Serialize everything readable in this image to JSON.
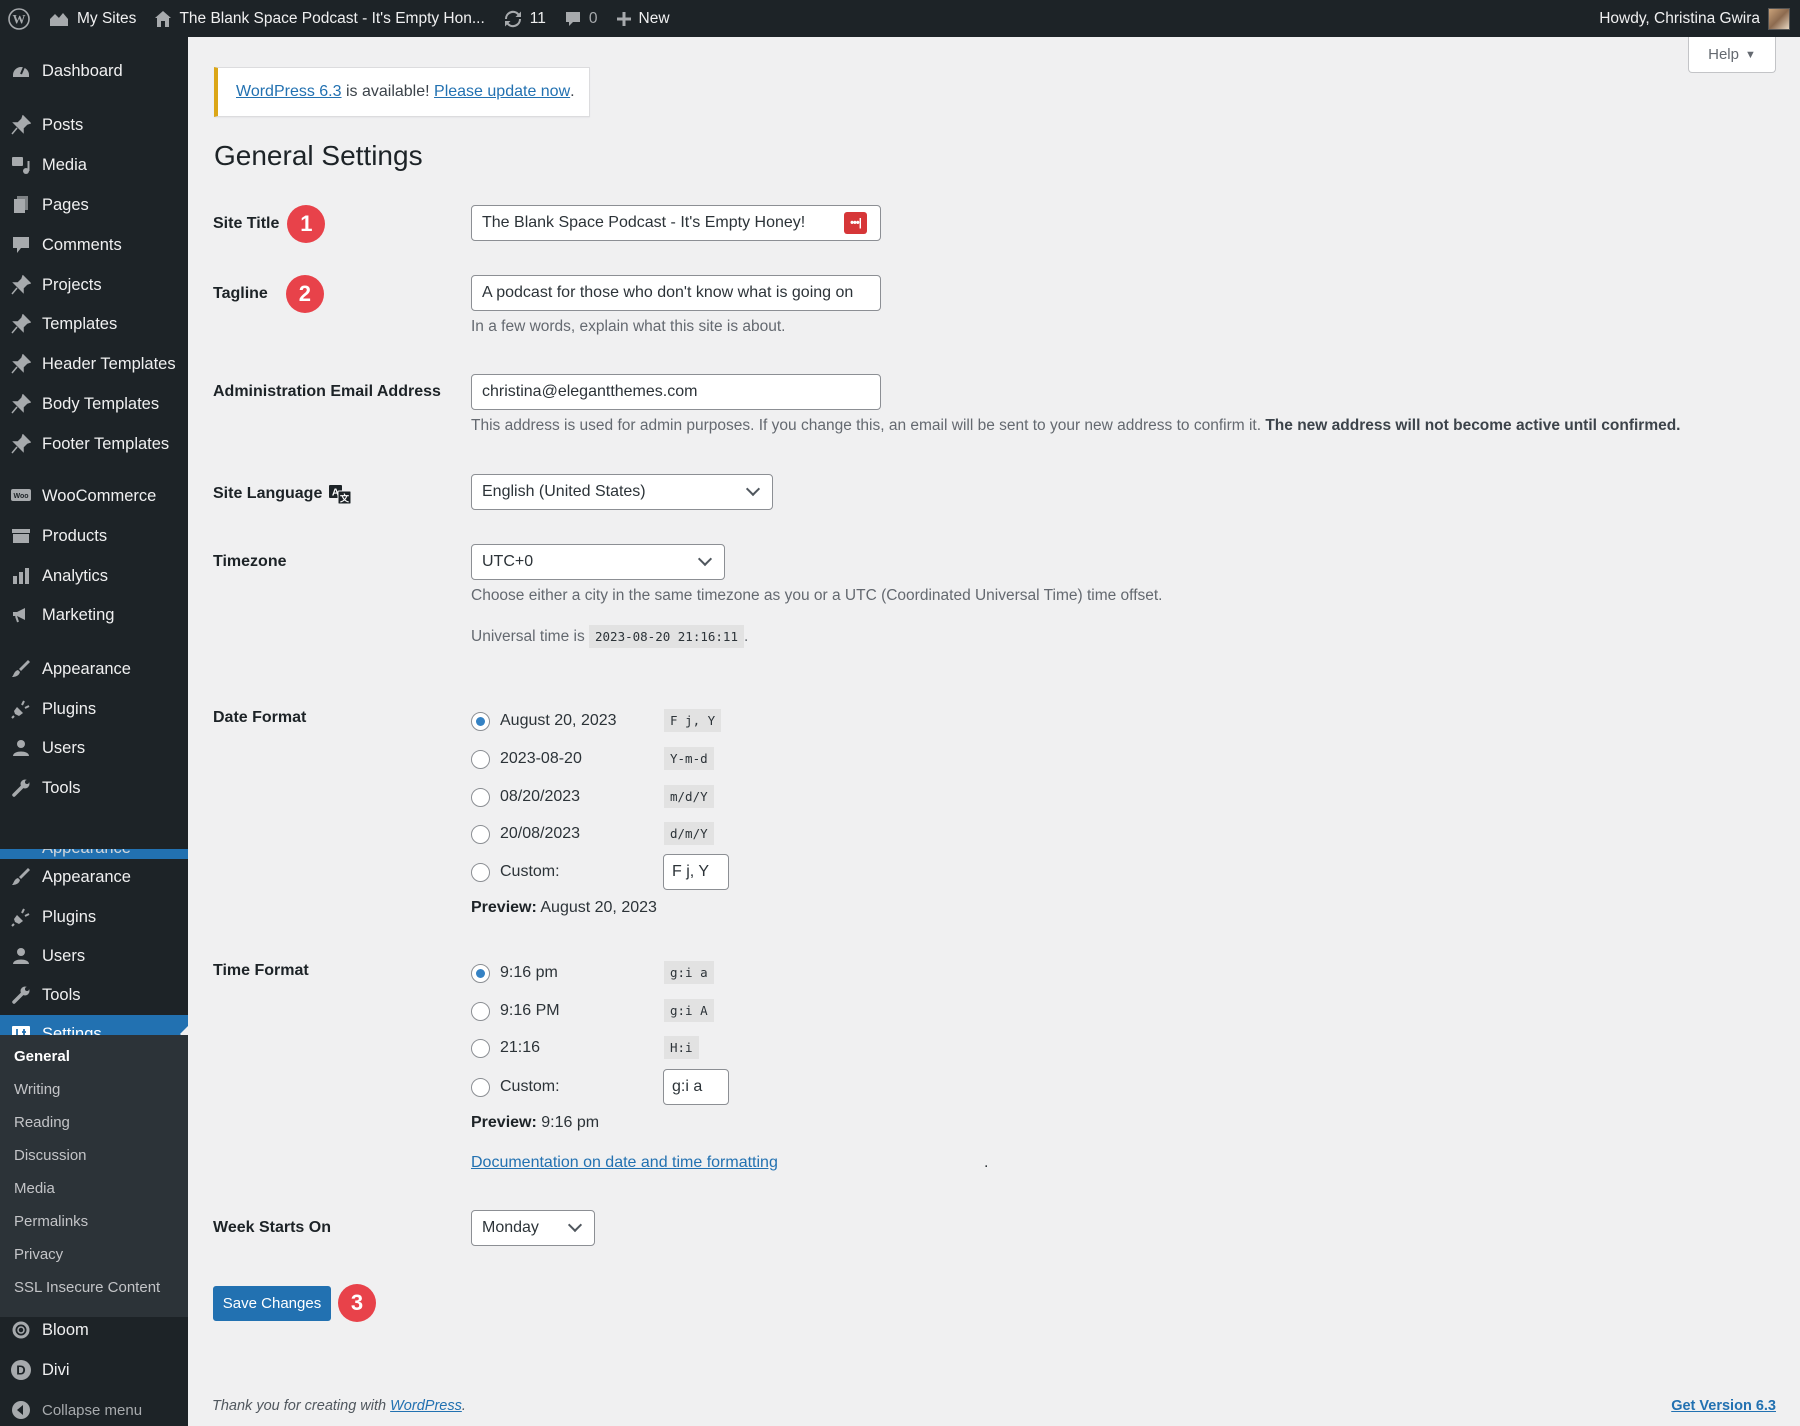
{
  "admin_bar": {
    "wp_logo": "wordpress-logo",
    "my_sites": "My Sites",
    "site_name": "The Blank Space Podcast - It's Empty Hon...",
    "updates_count": "11",
    "comments_count": "0",
    "new_label": "New",
    "howdy": "Howdy, Christina Gwira"
  },
  "help_label": "Help",
  "sidebar": {
    "items": [
      {
        "label": "Dashboard",
        "icon": "dashboard-icon"
      },
      {
        "label": "Posts",
        "icon": "pin-icon"
      },
      {
        "label": "Media",
        "icon": "media-icon"
      },
      {
        "label": "Pages",
        "icon": "pages-icon"
      },
      {
        "label": "Comments",
        "icon": "comment-icon"
      },
      {
        "label": "Projects",
        "icon": "pin-icon"
      },
      {
        "label": "Templates",
        "icon": "pin-icon"
      },
      {
        "label": "Header Templates",
        "icon": "pin-icon"
      },
      {
        "label": "Body Templates",
        "icon": "pin-icon"
      },
      {
        "label": "Footer Templates",
        "icon": "pin-icon"
      },
      {
        "label": "WooCommerce",
        "icon": "woo-icon"
      },
      {
        "label": "Products",
        "icon": "archive-icon"
      },
      {
        "label": "Analytics",
        "icon": "bar-chart-icon"
      },
      {
        "label": "Marketing",
        "icon": "megaphone-icon"
      },
      {
        "label": "Appearance",
        "icon": "paintbrush-icon"
      },
      {
        "label": "Plugins",
        "icon": "plug-icon"
      },
      {
        "label": "Users",
        "icon": "user-icon"
      },
      {
        "label": "Tools",
        "icon": "wrench-icon"
      },
      {
        "label": "Appearance",
        "icon": "paintbrush-icon"
      },
      {
        "label": "Plugins",
        "icon": "plug-icon"
      },
      {
        "label": "Users",
        "icon": "user-icon"
      },
      {
        "label": "Tools",
        "icon": "wrench-icon"
      },
      {
        "label": "Settings",
        "icon": "settings-icon"
      },
      {
        "label": "Bloom",
        "icon": "bloom-icon"
      },
      {
        "label": "Divi",
        "icon": "divi-icon"
      },
      {
        "label": "Collapse menu",
        "icon": "collapse-icon"
      }
    ],
    "submenu": [
      "General",
      "Writing",
      "Reading",
      "Discussion",
      "Media",
      "Permalinks",
      "Privacy",
      "SSL Insecure Content"
    ]
  },
  "notice": {
    "link1": "WordPress 6.3",
    "middle": " is available! ",
    "link2": "Please update now",
    "end": "."
  },
  "page_title": "General Settings",
  "fields": {
    "site_title": {
      "label": "Site Title",
      "value": "The Blank Space Podcast - It's Empty Honey!",
      "badge": "1"
    },
    "tagline": {
      "label": "Tagline",
      "value": "A podcast for those who don't know what is going on",
      "badge": "2",
      "desc": "In a few words, explain what this site is about."
    },
    "admin_email": {
      "label": "Administration Email Address",
      "value": "christina@elegantthemes.com",
      "desc": "This address is used for admin purposes. If you change this, an email will be sent to your new address to confirm it. ",
      "desc_bold": "The new address will not become active until confirmed."
    },
    "site_language": {
      "label": "Site Language",
      "value": "English (United States)"
    },
    "timezone": {
      "label": "Timezone",
      "value": "UTC+0",
      "desc": "Choose either a city in the same timezone as you or a UTC (Coordinated Universal Time) time offset.",
      "universal_prefix": "Universal time is ",
      "universal_time": "2023-08-20 21:16:11",
      "universal_suffix": "."
    },
    "date_format": {
      "label": "Date Format",
      "options": [
        {
          "label": "August 20, 2023",
          "code": "F j, Y",
          "checked": true
        },
        {
          "label": "2023-08-20",
          "code": "Y-m-d",
          "checked": false
        },
        {
          "label": "08/20/2023",
          "code": "m/d/Y",
          "checked": false
        },
        {
          "label": "20/08/2023",
          "code": "d/m/Y",
          "checked": false
        },
        {
          "label": "Custom:",
          "custom_value": "F j, Y",
          "checked": false
        }
      ],
      "preview_label": "Preview:",
      "preview_value": " August 20, 2023"
    },
    "time_format": {
      "label": "Time Format",
      "options": [
        {
          "label": "9:16 pm",
          "code": "g:i a",
          "checked": true
        },
        {
          "label": "9:16 PM",
          "code": "g:i A",
          "checked": false
        },
        {
          "label": "21:16",
          "code": "H:i",
          "checked": false
        },
        {
          "label": "Custom:",
          "custom_value": "g:i a",
          "checked": false
        }
      ],
      "preview_label": "Preview:",
      "preview_value": " 9:16 pm",
      "doc_link": "Documentation on date and time formatting"
    },
    "week_starts": {
      "label": "Week Starts On",
      "value": "Monday"
    }
  },
  "save_button": {
    "label": "Save Changes",
    "badge": "3"
  },
  "footer": {
    "thanks": "Thank you for creating with ",
    "wp_link": "WordPress",
    "thanks_end": ".",
    "version_link": "Get Version 6.3"
  }
}
